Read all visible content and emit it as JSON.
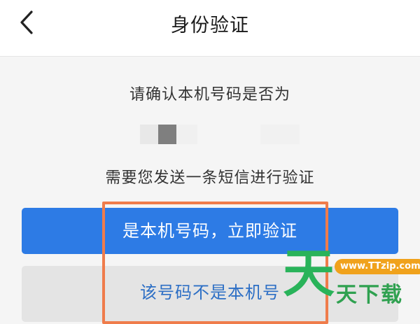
{
  "header": {
    "title": "身份验证"
  },
  "main": {
    "prompt": "请确认本机号码是否为",
    "sms_note": "需要您发送一条短信进行验证",
    "confirm_button": "是本机号码，立即验证",
    "not_mine_button": "该号码不是本机号"
  },
  "watermark": {
    "logo_char": "天",
    "url": "www.TTzip.com",
    "text": "天下载"
  },
  "colors": {
    "primary": "#2d7be5",
    "link": "#2d6fc5",
    "highlight": "#ef7c4b",
    "watermark_green": "#29b35a",
    "watermark_orange": "#f0a21c"
  },
  "icons": {
    "back": "chevron-left-icon"
  }
}
